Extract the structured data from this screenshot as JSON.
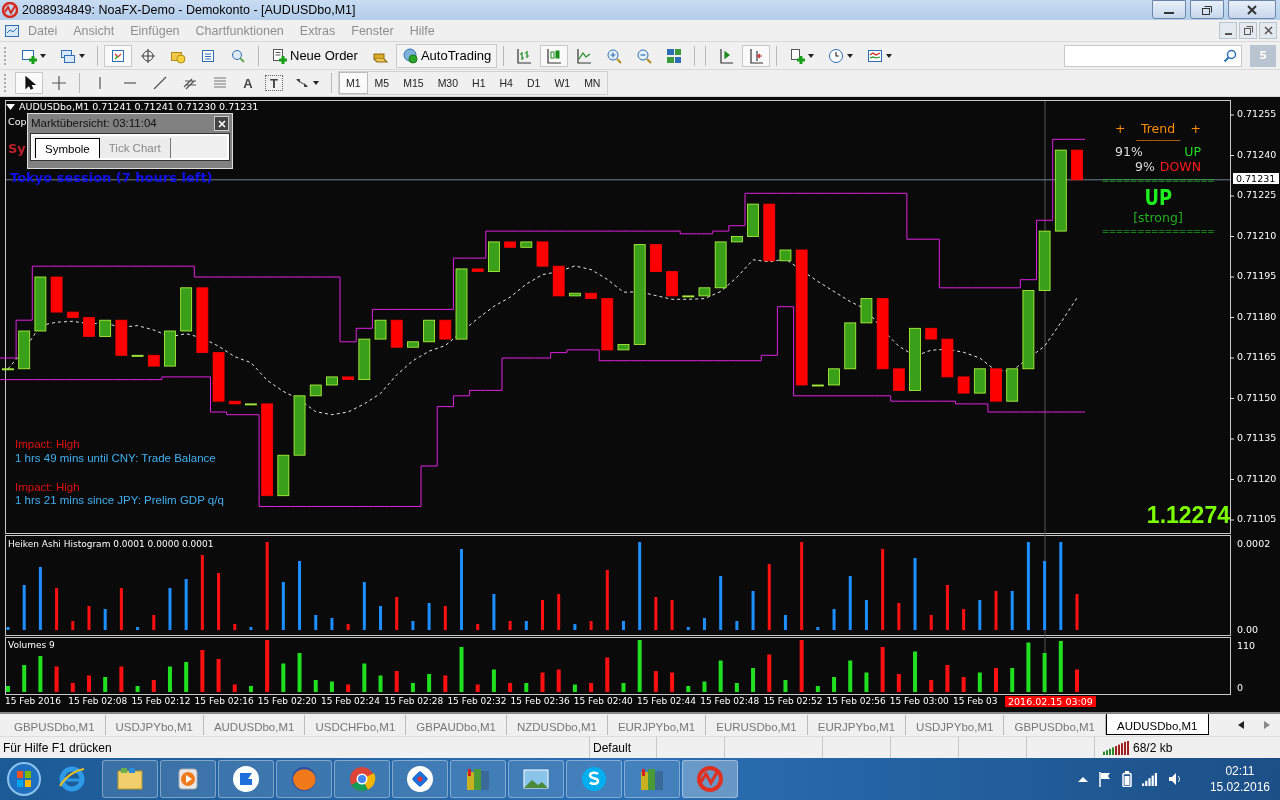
{
  "window": {
    "title": "2088934849: NoaFX-Demo - Demokonto - [AUDUSDbo,M1]"
  },
  "menu": [
    "Datei",
    "Ansicht",
    "Einfügen",
    "Chartfunktionen",
    "Extras",
    "Fenster",
    "Hilfe"
  ],
  "toolbar": {
    "new_order": "Neue Order",
    "autotrading": "AutoTrading",
    "notifications": "5"
  },
  "drawing_tools": {
    "text_tool": "A",
    "label_tool": "T"
  },
  "timeframes": [
    {
      "label": "M1",
      "selected": true
    },
    {
      "label": "M5",
      "selected": false
    },
    {
      "label": "M15",
      "selected": false
    },
    {
      "label": "M30",
      "selected": false
    },
    {
      "label": "H1",
      "selected": false
    },
    {
      "label": "H4",
      "selected": false
    },
    {
      "label": "D1",
      "selected": false
    },
    {
      "label": "W1",
      "selected": false
    },
    {
      "label": "MN",
      "selected": false
    }
  ],
  "chart": {
    "header": "AUDUSDbo,M1  0.71241 0.71241 0.71230 0.71231",
    "copyright_fragment": "Cop",
    "symbol_fragment": "Sy",
    "session": "Tokyo session (7 hours left)",
    "popup": {
      "title": "Marktübersicht: 03:11:04",
      "tabs": [
        {
          "label": "Symbole",
          "selected": true
        },
        {
          "label": "Tick Chart",
          "selected": false
        }
      ]
    },
    "trend": {
      "markers": [
        "+",
        "+"
      ],
      "title": "Trend",
      "dash_line": "----------------",
      "up_pct": "91%",
      "up_label": "UP",
      "down_pct": "9%",
      "down_label": "DOWN",
      "separators": [
        "================",
        "================"
      ],
      "direction": "UP",
      "strength": "[strong]"
    },
    "news": [
      {
        "impact": "Impact: High",
        "text": "1 hrs 49 mins until CNY: Trade Balance"
      },
      {
        "impact": "Impact: High",
        "text": "1 hrs 21 mins since JPY: Prelim GDP q/q"
      }
    ],
    "big_price": "1.12274",
    "current_price": "0.71231",
    "time_label": "2016.02.15 03:09",
    "histogram": {
      "label": "Heiken Ashi Histogram 0.0001 0.0000 0.0001",
      "ticks": [
        "0.0002",
        "0.00"
      ]
    },
    "volumes": {
      "label": "Volumes 9",
      "ticks": [
        "110",
        "0"
      ]
    },
    "price_ticks": [
      "0.71255",
      "0.71240",
      "0.71225",
      "0.71210",
      "0.71195",
      "0.71180",
      "0.71165",
      "0.71150",
      "0.71135",
      "0.71120",
      "0.71105"
    ],
    "time_ticks": [
      "15 Feb 2016",
      "15 Feb 02:08",
      "15 Feb 02:12",
      "15 Feb 02:16",
      "15 Feb 02:20",
      "15 Feb 02:24",
      "15 Feb 02:28",
      "15 Feb 02:32",
      "15 Feb 02:36",
      "15 Feb 02:40",
      "15 Feb 02:44",
      "15 Feb 02:48",
      "15 Feb 02:52",
      "15 Feb 02:56",
      "15 Feb 03:00",
      "15 Feb 03"
    ]
  },
  "chart_tabs": [
    {
      "label": "GBPUSDbo,M1",
      "selected": false
    },
    {
      "label": "USDJPYbo,M1",
      "selected": false
    },
    {
      "label": "AUDUSDbo,M1",
      "selected": false
    },
    {
      "label": "USDCHFbo,M1",
      "selected": false
    },
    {
      "label": "GBPAUDbo,M1",
      "selected": false
    },
    {
      "label": "NZDUSDbo,M1",
      "selected": false
    },
    {
      "label": "EURJPYbo,M1",
      "selected": false
    },
    {
      "label": "EURUSDbo,M1",
      "selected": false
    },
    {
      "label": "EURJPYbo,M1",
      "selected": false
    },
    {
      "label": "USDJPYbo,M1",
      "selected": false
    },
    {
      "label": "GBPUSDbo,M1",
      "selected": false
    },
    {
      "label": "AUDUSDbo,M1",
      "selected": true
    }
  ],
  "status_bar": {
    "help": "Für Hilfe F1 drücken",
    "profile": "Default",
    "traffic": "68/2 kb"
  },
  "taskbar": {
    "time": "02:11",
    "date": "15.02.2016"
  }
}
